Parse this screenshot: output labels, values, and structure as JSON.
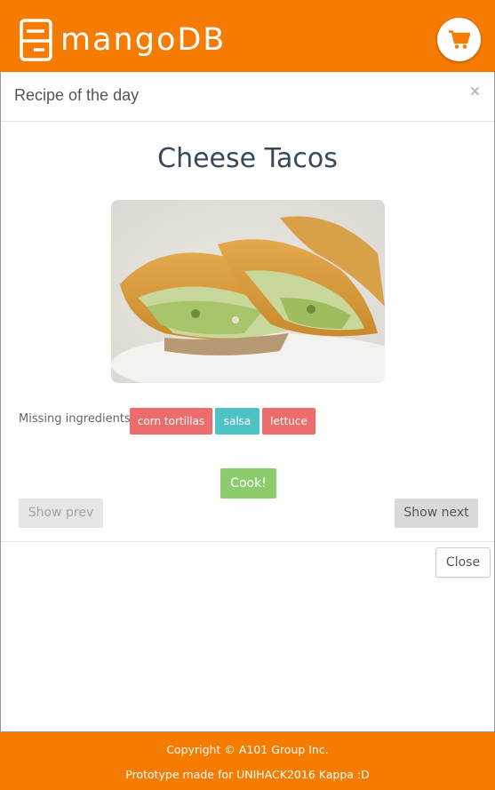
{
  "brand": {
    "name": "mangoDB",
    "logo_icon": "fridge-icon",
    "color": "#f57c00"
  },
  "header": {
    "cart_icon": "shopping-cart-icon"
  },
  "modal": {
    "title": "Recipe of the day",
    "close_symbol": "×",
    "recipe": {
      "name": "Cheese Tacos",
      "image_subject": "cheese tacos"
    },
    "missing_label": "Missing ingredients:",
    "ingredients": [
      {
        "label": "corn tortillas",
        "color": "#ef6c6c"
      },
      {
        "label": "salsa",
        "color": "#4fc2c7"
      },
      {
        "label": "lettuce",
        "color": "#ef6c6c"
      }
    ],
    "cook_label": "Cook!",
    "prev_label": "Show prev",
    "next_label": "Show next",
    "close_label": "Close"
  },
  "footer": {
    "copyright": "Copyright © A101 Group Inc.",
    "prototype": "Prototype made for UNIHACK2016 Kappa :D"
  }
}
